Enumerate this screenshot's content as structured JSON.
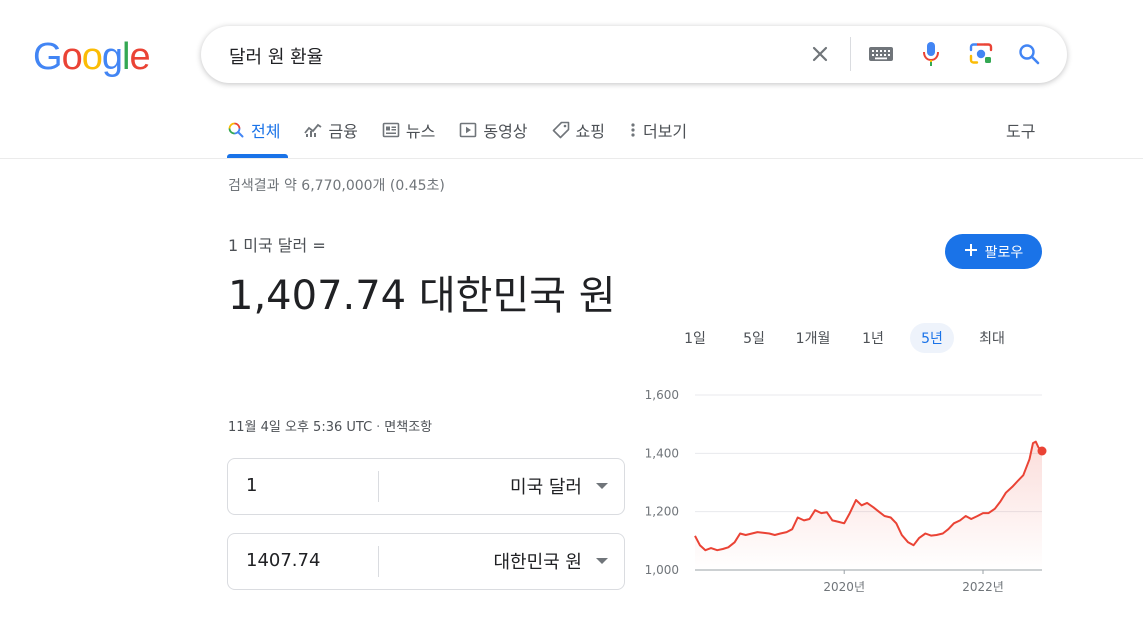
{
  "colors": {
    "accent": "#1a73e8",
    "chart_line": "#ea4335",
    "google_blue": "#4285f4",
    "google_red": "#ea4335",
    "google_yellow": "#fbbc05",
    "google_green": "#34a853"
  },
  "logo": {
    "letters": [
      "G",
      "o",
      "o",
      "g",
      "l",
      "e"
    ]
  },
  "search": {
    "query": "달러 원 환율"
  },
  "search_icons": [
    "close-icon",
    "keyboard-icon",
    "mic-icon",
    "camera-lens-icon",
    "search-icon"
  ],
  "tabs": [
    {
      "label": "전체",
      "icon": "search-icon",
      "active": true
    },
    {
      "label": "금융",
      "icon": "finance-icon"
    },
    {
      "label": "뉴스",
      "icon": "news-icon"
    },
    {
      "label": "동영상",
      "icon": "play-icon"
    },
    {
      "label": "쇼핑",
      "icon": "tag-icon"
    },
    {
      "label": "더보기",
      "icon": "more-vert-icon"
    }
  ],
  "tools_label": "도구",
  "result_stats": "검색결과 약 6,770,000개 (0.45초)",
  "converter": {
    "from_label": "1 미국 달러 =",
    "to_value": "1,407.74 대한민국 원",
    "timestamp": "11월 4일 오후 5:36 UTC",
    "separator": "·",
    "disclaimer": "면책조항",
    "from_amount": "1",
    "from_currency": "미국 달러",
    "to_amount": "1407.74",
    "to_currency": "대한민국 원"
  },
  "follow_button": {
    "label": "팔로우",
    "icon": "plus-icon"
  },
  "range_tabs": [
    {
      "label": "1일"
    },
    {
      "label": "5일"
    },
    {
      "label": "1개월"
    },
    {
      "label": "1년"
    },
    {
      "label": "5년",
      "selected": true
    },
    {
      "label": "최대"
    }
  ],
  "chart_data": {
    "type": "line",
    "y_ticks": [
      "1,600",
      "1,400",
      "1,200",
      "1,000"
    ],
    "ylim": [
      1000,
      1600
    ],
    "x_ticks": [
      {
        "label": "2020년",
        "x": 2020.0
      },
      {
        "label": "2022년",
        "x": 2022.0
      }
    ],
    "xlim": [
      2017.85,
      2022.85
    ],
    "series": [
      {
        "values": [
          [
            2017.85,
            1117
          ],
          [
            2017.92,
            1085
          ],
          [
            2018.0,
            1068
          ],
          [
            2018.08,
            1075
          ],
          [
            2018.17,
            1068
          ],
          [
            2018.25,
            1072
          ],
          [
            2018.33,
            1078
          ],
          [
            2018.42,
            1095
          ],
          [
            2018.5,
            1125
          ],
          [
            2018.58,
            1120
          ],
          [
            2018.67,
            1125
          ],
          [
            2018.75,
            1130
          ],
          [
            2018.83,
            1128
          ],
          [
            2018.92,
            1125
          ],
          [
            2019.0,
            1120
          ],
          [
            2019.08,
            1125
          ],
          [
            2019.17,
            1130
          ],
          [
            2019.25,
            1140
          ],
          [
            2019.33,
            1180
          ],
          [
            2019.42,
            1170
          ],
          [
            2019.5,
            1175
          ],
          [
            2019.58,
            1205
          ],
          [
            2019.67,
            1195
          ],
          [
            2019.75,
            1198
          ],
          [
            2019.83,
            1170
          ],
          [
            2019.92,
            1165
          ],
          [
            2020.0,
            1160
          ],
          [
            2020.08,
            1195
          ],
          [
            2020.17,
            1240
          ],
          [
            2020.25,
            1222
          ],
          [
            2020.33,
            1230
          ],
          [
            2020.42,
            1215
          ],
          [
            2020.5,
            1200
          ],
          [
            2020.58,
            1185
          ],
          [
            2020.67,
            1180
          ],
          [
            2020.75,
            1160
          ],
          [
            2020.83,
            1120
          ],
          [
            2020.92,
            1095
          ],
          [
            2021.0,
            1085
          ],
          [
            2021.08,
            1110
          ],
          [
            2021.17,
            1125
          ],
          [
            2021.25,
            1118
          ],
          [
            2021.33,
            1120
          ],
          [
            2021.42,
            1125
          ],
          [
            2021.5,
            1140
          ],
          [
            2021.58,
            1160
          ],
          [
            2021.67,
            1170
          ],
          [
            2021.75,
            1185
          ],
          [
            2021.83,
            1175
          ],
          [
            2021.92,
            1185
          ],
          [
            2022.0,
            1195
          ],
          [
            2022.08,
            1195
          ],
          [
            2022.17,
            1210
          ],
          [
            2022.25,
            1235
          ],
          [
            2022.33,
            1265
          ],
          [
            2022.42,
            1285
          ],
          [
            2022.5,
            1305
          ],
          [
            2022.58,
            1325
          ],
          [
            2022.67,
            1380
          ],
          [
            2022.72,
            1435
          ],
          [
            2022.76,
            1440
          ],
          [
            2022.8,
            1420
          ],
          [
            2022.85,
            1408
          ]
        ]
      }
    ],
    "grid": true
  }
}
